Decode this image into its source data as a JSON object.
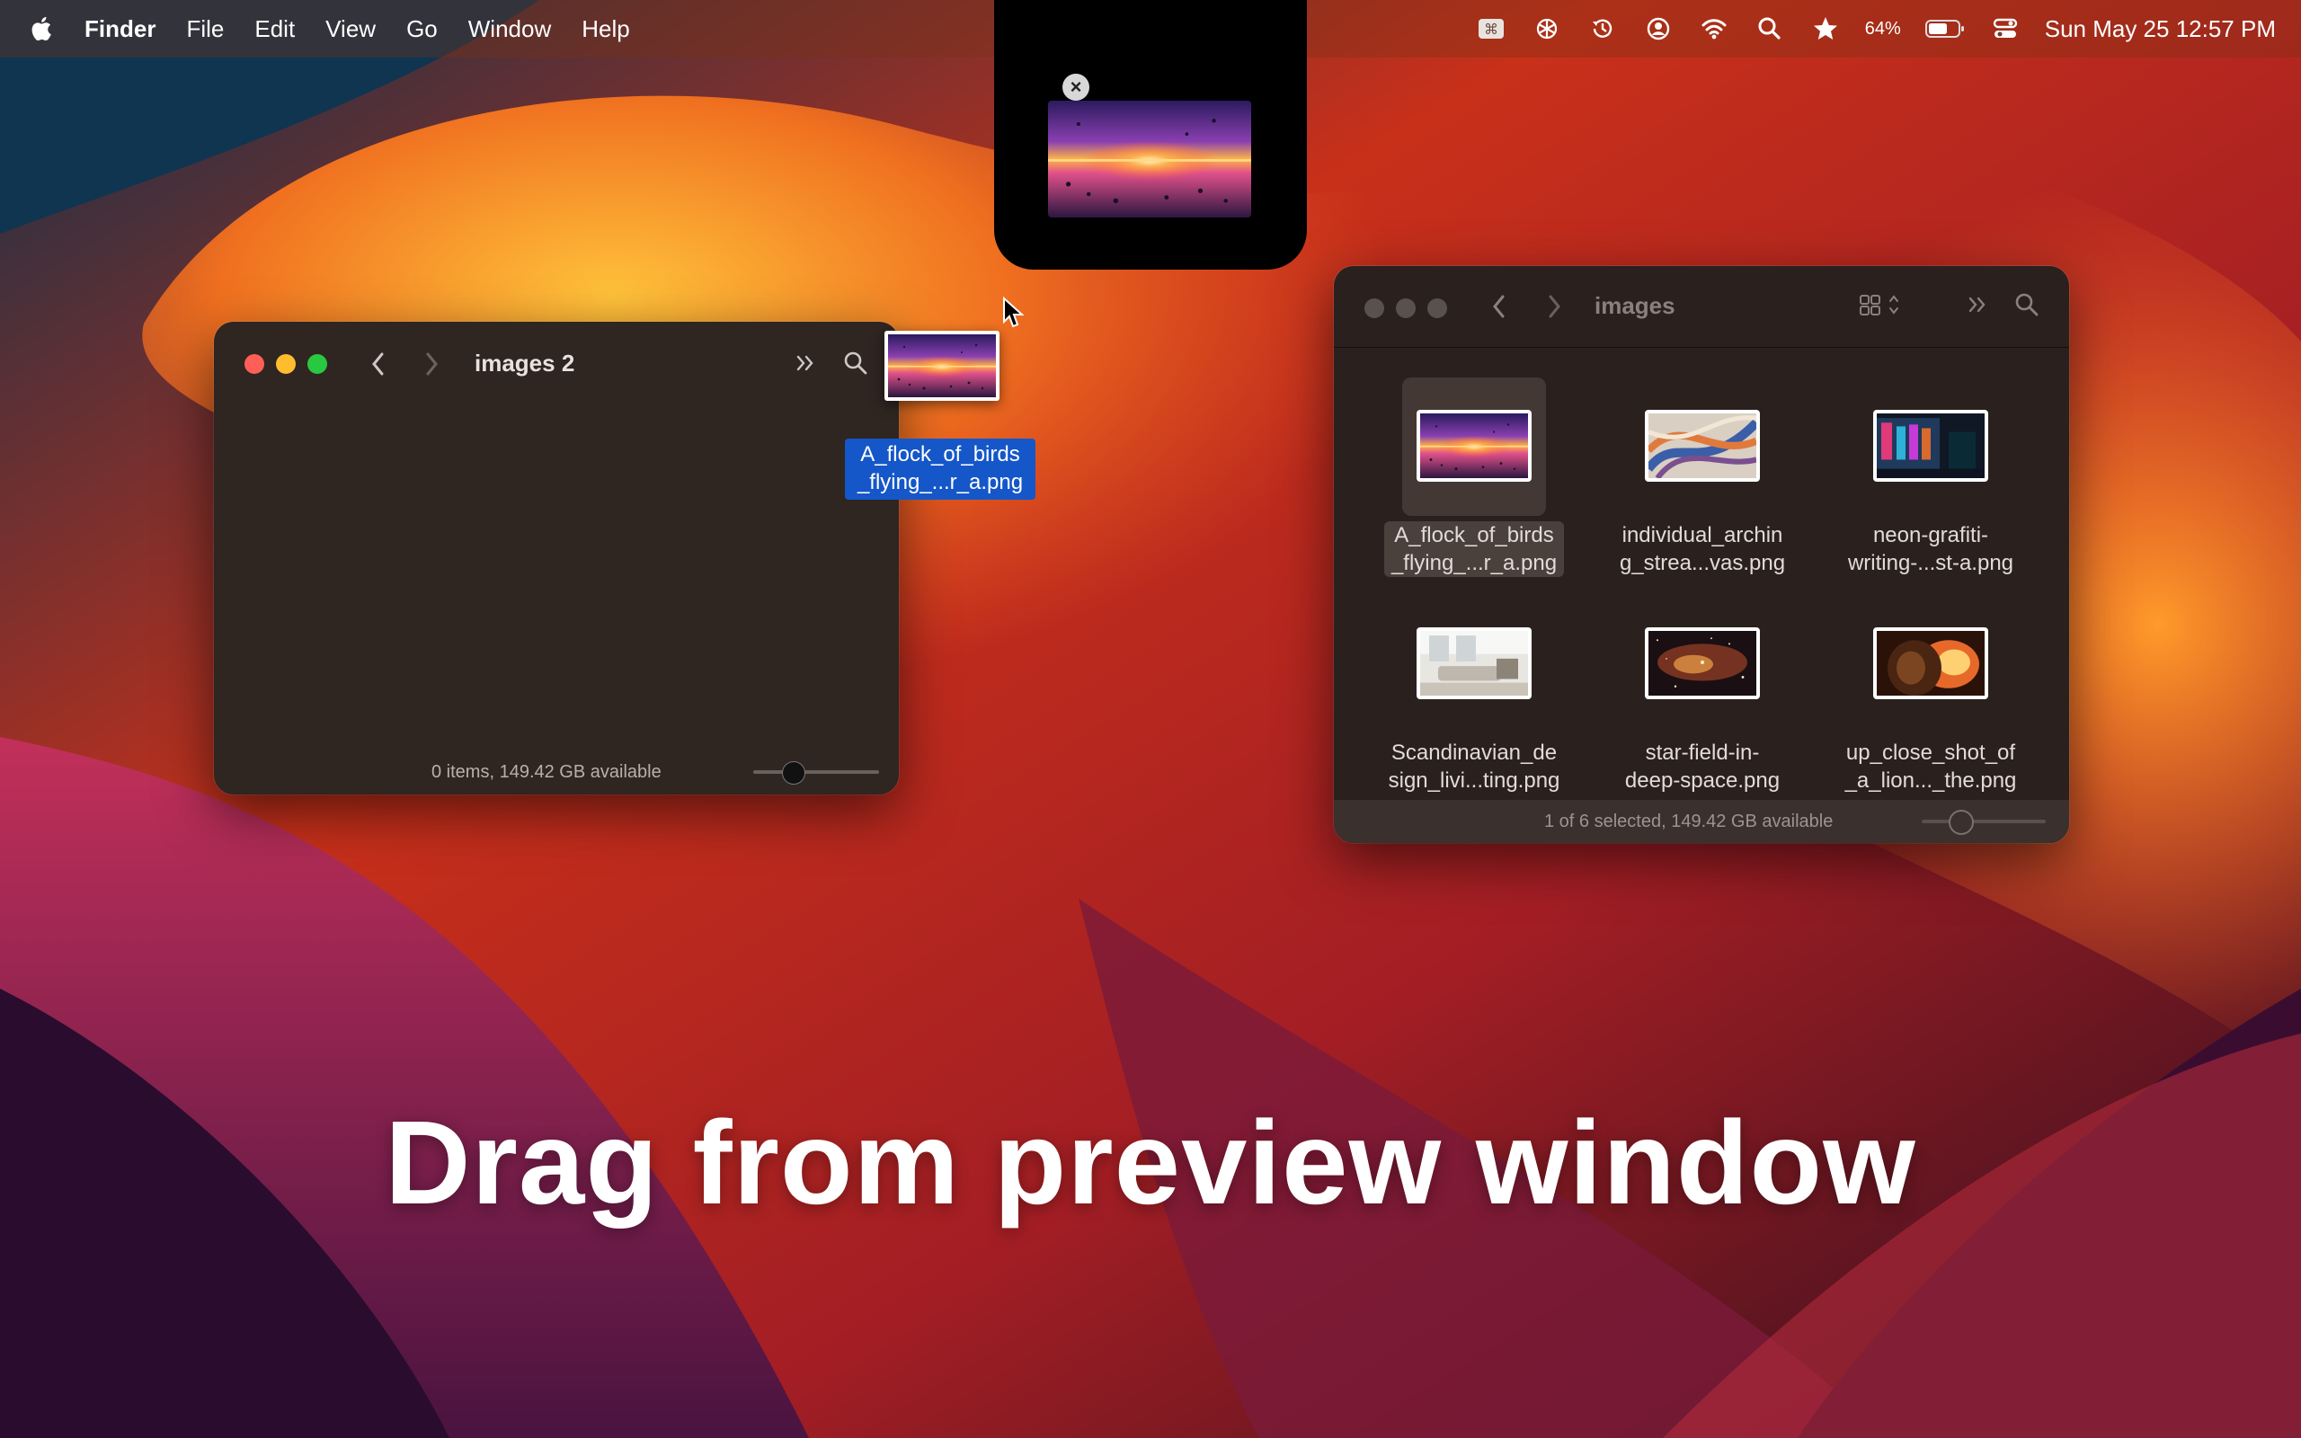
{
  "menubar": {
    "app_name": "Finder",
    "menus": [
      "File",
      "Edit",
      "View",
      "Go",
      "Window",
      "Help"
    ],
    "status_icons": [
      "command-key-icon",
      "openai-icon",
      "time-machine-icon",
      "user-account-icon",
      "wifi-icon",
      "spotlight-search-icon",
      "star-icon",
      "battery-icon",
      "control-center-icon"
    ],
    "battery_percent": "64%",
    "datetime": "Sun May 25  12:57 PM"
  },
  "notch_preview": {
    "close_glyph": "×"
  },
  "left_window": {
    "title": "images 2",
    "status": "0 items, 149.42 GB available",
    "icon_size_level": 0.33
  },
  "drag": {
    "label_line1": "A_flock_of_birds",
    "label_line2": "_flying_...r_a.png"
  },
  "right_window": {
    "title": "images",
    "status": "1 of 6 selected, 149.42 GB available",
    "icon_size_level": 0.33,
    "items": [
      {
        "line1": "A_flock_of_birds",
        "line2": "_flying_...r_a.png",
        "selected": true
      },
      {
        "line1": "individual_archin",
        "line2": "g_strea...vas.png",
        "selected": false
      },
      {
        "line1": "neon-grafiti-",
        "line2": "writing-...st-a.png",
        "selected": false
      },
      {
        "line1": "Scandinavian_de",
        "line2": "sign_livi...ting.png",
        "selected": false
      },
      {
        "line1": "star-field-in-",
        "line2": "deep-space.png",
        "selected": false
      },
      {
        "line1": "up_close_shot_of",
        "line2": "_a_lion..._the.png",
        "selected": false
      }
    ]
  },
  "caption": "Drag from preview window",
  "colors": {
    "selection_blue": "#1557c9",
    "traffic_red": "#ff5f57",
    "traffic_yellow": "#febc2e",
    "traffic_green": "#28c840"
  }
}
